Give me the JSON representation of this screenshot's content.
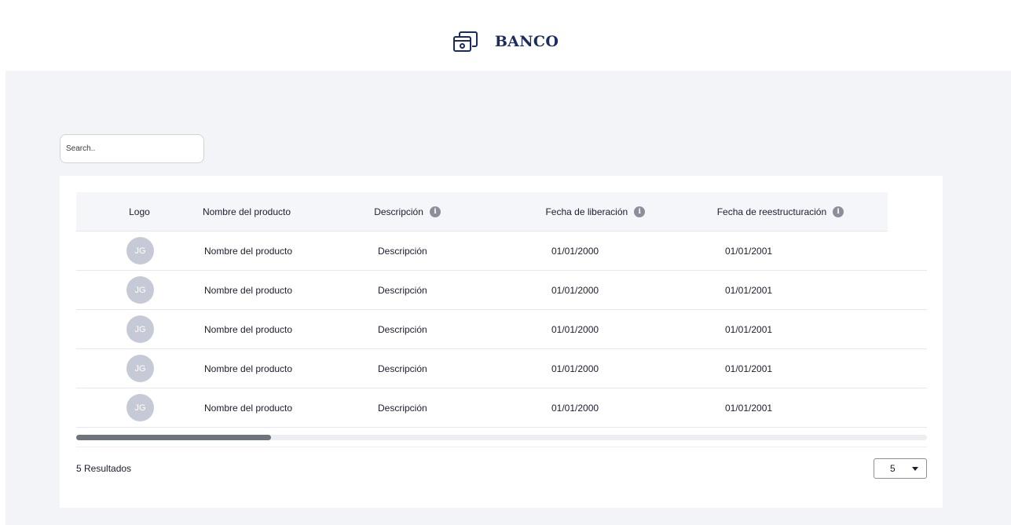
{
  "brand": {
    "name": "BANCO",
    "icon": "bank-card-icon"
  },
  "search": {
    "placeholder": "Search..",
    "value": ""
  },
  "table": {
    "headers": {
      "logo": "Logo",
      "product": "Nombre del producto",
      "description": "Descripción",
      "release_date": "Fecha de liberación",
      "restructure_date": "Fecha de reestructuración"
    },
    "rows": [
      {
        "avatar": "JG",
        "product": "Nombre del producto",
        "description": "Descripción",
        "release_date": "01/01/2000",
        "restructure_date": "01/01/2001"
      },
      {
        "avatar": "JG",
        "product": "Nombre del producto",
        "description": "Descripción",
        "release_date": "01/01/2000",
        "restructure_date": "01/01/2001"
      },
      {
        "avatar": "JG",
        "product": "Nombre del producto",
        "description": "Descripción",
        "release_date": "01/01/2000",
        "restructure_date": "01/01/2001"
      },
      {
        "avatar": "JG",
        "product": "Nombre del producto",
        "description": "Descripción",
        "release_date": "01/01/2000",
        "restructure_date": "01/01/2001"
      },
      {
        "avatar": "JG",
        "product": "Nombre del producto",
        "description": "Descripción",
        "release_date": "01/01/2000",
        "restructure_date": "01/01/2001"
      }
    ]
  },
  "footer": {
    "results": "5 Resultados",
    "page_size": "5"
  },
  "colors": {
    "brand": "#1b2b5e",
    "background": "#f3f4f7",
    "avatar": "#c6cad6"
  }
}
